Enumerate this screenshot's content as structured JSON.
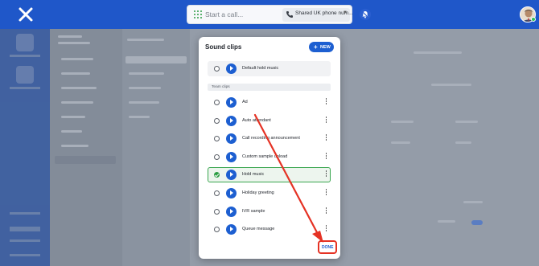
{
  "topbar": {
    "call_placeholder": "Start a call...",
    "phone_select_value": "Shared UK phone num..."
  },
  "modal": {
    "title": "Sound clips",
    "new_button": "NEW",
    "default_clip": "Default hold music",
    "section_label": "Team clips",
    "clips": [
      {
        "name": "Ad",
        "selected": false
      },
      {
        "name": "Auto attendant",
        "selected": false
      },
      {
        "name": "Call recording announcement",
        "selected": false
      },
      {
        "name": "Custom sample upload",
        "selected": false
      },
      {
        "name": "Hold music",
        "selected": true
      },
      {
        "name": "Holiday greeting",
        "selected": false
      },
      {
        "name": "IVR sample",
        "selected": false
      },
      {
        "name": "Queue message",
        "selected": false
      }
    ],
    "done_button": "DONE"
  },
  "colors": {
    "brand_blue": "#1f57c9",
    "accent_blue": "#1d5fd1",
    "selected_green": "#2e9e45",
    "annotation_red": "#e53224"
  }
}
